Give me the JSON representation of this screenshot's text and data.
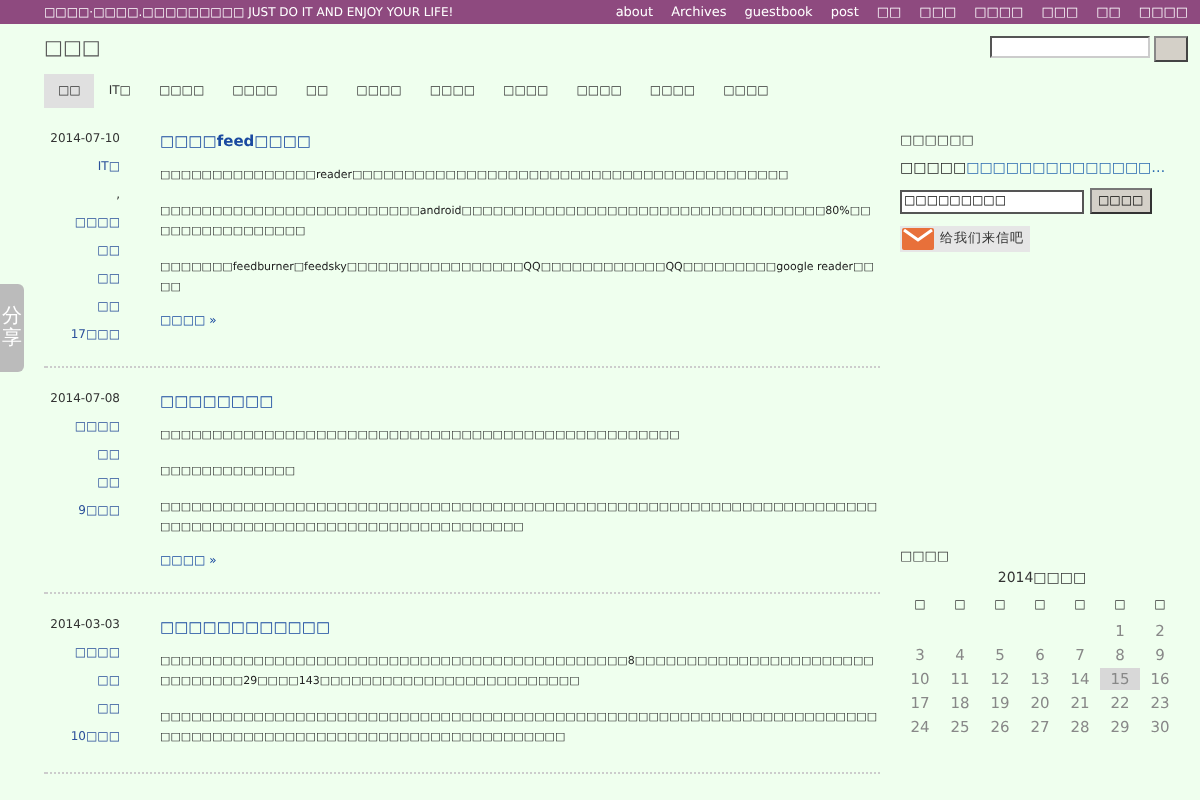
{
  "top_bar": {
    "tagline": "□□□□·□□□□.□□□□□□□□□ JUST DO IT AND ENJOY YOUR LIFE!",
    "links": [
      "about",
      "Archives",
      "guestbook",
      "post",
      "□□",
      "□□□",
      "□□□□",
      "□□□",
      "□□",
      "□□□□"
    ]
  },
  "site_title": "□□□",
  "category_separator": ",",
  "tabs": [
    {
      "label": "□□",
      "selected": true
    },
    {
      "label": "IT□",
      "selected": false
    },
    {
      "label": "□□□□",
      "selected": false
    },
    {
      "label": "□□□□",
      "selected": false
    },
    {
      "label": "□□",
      "selected": false
    },
    {
      "label": "□□□□",
      "selected": false
    },
    {
      "label": "□□□□",
      "selected": false
    },
    {
      "label": "□□□□",
      "selected": false
    },
    {
      "label": "□□□□",
      "selected": false
    },
    {
      "label": "□□□□",
      "selected": false
    },
    {
      "label": "□□□□",
      "selected": false
    }
  ],
  "posts": [
    {
      "date": "2014-07-10",
      "title": "□□□□feed□□□□",
      "categories": [
        "IT□",
        "□□□□"
      ],
      "links": [
        "□□",
        "□□",
        "□□"
      ],
      "comments": "17□□□",
      "paragraphs": [
        "□□□□□□□□□□□□□□□reader□□□□□□□□□□□□□□□□□□□□□□□□□□□□□□□□□□□□□□□□□□",
        "□□□□□□□□□□□□□□□□□□□□□□□□□android□□□□□□□□□□□□□□□□□□□□□□□□□□□□□□□□□□□80%□□□□□□□□□□□□□□□□",
        "□□□□□□□feedburner□feedsky□□□□□□□□□□□□□□□□□QQ□□□□□□□□□□□□QQ□□□□□□□□□google reader□□□□"
      ],
      "more": "□□□□ »"
    },
    {
      "date": "2014-07-08",
      "title": "□□□□□□□□",
      "categories": [
        "□□□□"
      ],
      "links": [
        "□□",
        "□□"
      ],
      "comments": "9□□□",
      "paragraphs": [
        "□□□□□□□□□□□□□□□□□□□□□□□□□□□□□□□□□□□□□□□□□□□□□□□□□□",
        "□□□□□□□□□□□□□",
        "□□□□□□□□□□□□□□□□□□□□□□□□□□□□□□□□□□□□□□□□□□□□□□□□□□□□□□□□□□□□□□□□□□□□□□□□□□□□□□□□□□□□□□□□□□□□□□□□□□□□□□□□"
      ],
      "more": "□□□□ »"
    },
    {
      "date": "2014-03-03",
      "title": "□□□□□□□□□□□□",
      "categories": [
        "□□□□"
      ],
      "links": [
        "□□",
        "□□"
      ],
      "comments": "10□□□",
      "paragraphs": [
        "□□□□□□□□□□□□□□□□□□□□□□□□□□□□□□□□□□□□□□□□□□□□□8□□□□□□□□□□□□□□□□□□□□□□□□□□□□□□□29□□□□143□□□□□□□□□□□□□□□□□□□□□□□□□",
        "□□□□□□□□□□□□□□□□□□□□□□□□□□□□□□□□□□□□□□□□□□□□□□□□□□□□□□□□□□□□□□□□□□□□□□□□□□□□□□□□□□□□□□□□□□□□□□□□□□□□□□□□□□□□"
      ]
    }
  ],
  "sidebar": {
    "subscribe": {
      "heading": "□□□□□□",
      "prefix": "□□□□□",
      "link": "□□□□□□□□□□□□□□…",
      "input_value": "□□□□□□□□□",
      "button": "□□□□",
      "mail_button": "给我们来信吧"
    },
    "calendar": {
      "heading": "□□□□",
      "caption": "2014□□□□",
      "weekdays": [
        "□",
        "□",
        "□",
        "□",
        "□",
        "□",
        "□"
      ],
      "weeks": [
        [
          {
            "label": "1",
            "selected": false
          },
          {
            "label": "2",
            "selected": false
          }
        ],
        [
          {
            "label": "3",
            "selected": false
          },
          {
            "label": "4",
            "selected": false
          },
          {
            "label": "5",
            "selected": false
          },
          {
            "label": "6",
            "selected": false
          },
          {
            "label": "7",
            "selected": false
          },
          {
            "label": "8",
            "selected": false
          },
          {
            "label": "9",
            "selected": false
          }
        ],
        [
          {
            "label": "10",
            "selected": false
          },
          {
            "label": "11",
            "selected": false
          },
          {
            "label": "12",
            "selected": false
          },
          {
            "label": "13",
            "selected": false
          },
          {
            "label": "14",
            "selected": false
          },
          {
            "label": "15",
            "selected": true
          },
          {
            "label": "16",
            "selected": false
          }
        ],
        [
          {
            "label": "17",
            "selected": false
          },
          {
            "label": "18",
            "selected": false
          },
          {
            "label": "19",
            "selected": false
          },
          {
            "label": "20",
            "selected": false
          },
          {
            "label": "21",
            "selected": false
          },
          {
            "label": "22",
            "selected": false
          },
          {
            "label": "23",
            "selected": false
          }
        ],
        [
          {
            "label": "24",
            "selected": false
          },
          {
            "label": "25",
            "selected": false
          },
          {
            "label": "26",
            "selected": false
          },
          {
            "label": "27",
            "selected": false
          },
          {
            "label": "28",
            "selected": false
          },
          {
            "label": "29",
            "selected": false
          },
          {
            "label": "30",
            "selected": false
          }
        ]
      ]
    }
  },
  "share_tab": "分享"
}
